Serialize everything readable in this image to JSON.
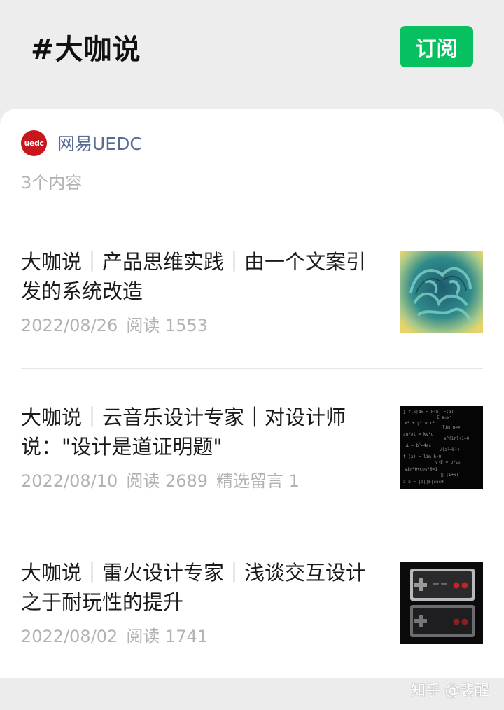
{
  "header": {
    "title": "#大咖说",
    "subscribe_label": "订阅"
  },
  "author": {
    "avatar_text": "uedc",
    "name": "网易UEDC",
    "content_count": "3个内容"
  },
  "articles": [
    {
      "title": "大咖说｜产品思维实践｜由一个文案引发的系统改造",
      "date": "2022/08/26",
      "reads": "阅读 1553",
      "extra": "",
      "thumb_icon": "brain-illustration"
    },
    {
      "title": "大咖说｜云音乐设计专家｜对设计师说：\"设计是道证明题\"",
      "date": "2022/08/10",
      "reads": "阅读 2689",
      "extra": "精选留言 1",
      "thumb_icon": "math-formula-chalkboard"
    },
    {
      "title": "大咖说｜雷火设计专家｜浅谈交互设计之于耐玩性的提升",
      "date": "2022/08/02",
      "reads": "阅读 1741",
      "extra": "",
      "thumb_icon": "game-controller"
    }
  ],
  "watermark": "知乎 @裴醒",
  "colors": {
    "accent": "#07c160",
    "author_link": "#576b95",
    "avatar_red": "#c8161d",
    "meta_gray": "#b2b2b2"
  }
}
